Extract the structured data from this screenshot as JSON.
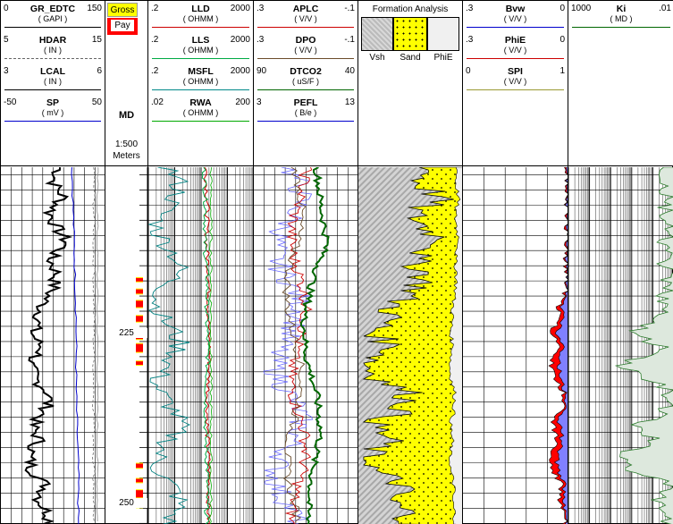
{
  "tracks": {
    "gr_track": {
      "curves": [
        {
          "name": "GR_EDTC",
          "unit": "( GAPI )",
          "min": "0",
          "max": "150",
          "color": "#000000",
          "style": "solid"
        },
        {
          "name": "HDAR",
          "unit": "( IN )",
          "min": "5",
          "max": "15",
          "color": "#666666",
          "style": "dashed"
        },
        {
          "name": "LCAL",
          "unit": "( IN )",
          "min": "3",
          "max": "6",
          "color": "#000000",
          "style": "solid"
        },
        {
          "name": "SP",
          "unit": "( mV )",
          "min": "-50",
          "max": "50",
          "color": "#0000cc",
          "style": "solid"
        }
      ]
    },
    "depth_track": {
      "gross_label": "Gross",
      "pay_label": "Pay",
      "md_label": "MD",
      "scale_label": "1:500",
      "units_label": "Meters",
      "depth_ticks": [
        {
          "depth": 225,
          "label": "225"
        },
        {
          "depth": 250,
          "label": "250"
        }
      ]
    },
    "resistivity_track": {
      "curves": [
        {
          "name": "LLD",
          "unit": "( OHMM )",
          "min": ".2",
          "max": "2000",
          "color": "#cc0000"
        },
        {
          "name": "LLS",
          "unit": "( OHMM )",
          "min": ".2",
          "max": "2000",
          "color": "#00aa44"
        },
        {
          "name": "MSFL",
          "unit": "( OHMM )",
          "min": ".2",
          "max": "2000",
          "color": "#008080"
        },
        {
          "name": "RWA",
          "unit": "( OHMM )",
          "min": ".02",
          "max": "200",
          "color": "#00aa00"
        }
      ]
    },
    "porosity_track": {
      "curves": [
        {
          "name": "APLC",
          "unit": "( V/V )",
          "min": ".3",
          "max": "-.1",
          "color": "#cc0000"
        },
        {
          "name": "DPO",
          "unit": "( V/V )",
          "min": ".3",
          "max": "-.1",
          "color": "#6b4c2a"
        },
        {
          "name": "DTCO2",
          "unit": "( uS/F )",
          "min": "90",
          "max": "40",
          "color": "#006600"
        },
        {
          "name": "PEFL",
          "unit": "( B/e )",
          "min": "3",
          "max": "13",
          "color": "#0000cc"
        }
      ]
    },
    "formation_track": {
      "title": "Formation Analysis",
      "components": [
        {
          "name": "Vsh",
          "color": "#c0c0c0"
        },
        {
          "name": "Sand",
          "color": "#ffff00"
        },
        {
          "name": "PhiE",
          "color": "#f0f0f0"
        }
      ]
    },
    "saturation_track": {
      "curves": [
        {
          "name": "Bvw",
          "unit": "( V/V )",
          "min": ".3",
          "max": "0",
          "color": "#0000cc"
        },
        {
          "name": "PhiE",
          "unit": "( V/V )",
          "min": ".3",
          "max": "0",
          "color": "#cc0000"
        },
        {
          "name": "SPI",
          "unit": "( V/V )",
          "min": "0",
          "max": "1",
          "color": "#999933"
        }
      ]
    },
    "perm_track": {
      "curves": [
        {
          "name": "Ki",
          "unit": "( MD )",
          "min": "1000",
          "max": ".01",
          "color": "#006600"
        }
      ]
    }
  },
  "chart_data": {
    "type": "line",
    "title": "",
    "y_axis": {
      "label": "MD",
      "unit": "Meters",
      "scale": "1:500",
      "range_m": [
        205,
        252
      ]
    },
    "series": [
      {
        "name": "GR_EDTC",
        "unit": "GAPI",
        "range": [
          0,
          150
        ],
        "depth": [
          205,
          207,
          209,
          211,
          213,
          215,
          217,
          219,
          221,
          223,
          225,
          227,
          229,
          231,
          233,
          235,
          237,
          239,
          241,
          243,
          245,
          247,
          249,
          251
        ],
        "values": [
          85,
          75,
          90,
          70,
          80,
          95,
          70,
          80,
          75,
          60,
          55,
          45,
          60,
          40,
          50,
          70,
          65,
          45,
          55,
          40,
          45,
          65,
          55,
          70
        ]
      },
      {
        "name": "SP",
        "unit": "mV",
        "range": [
          -50,
          50
        ],
        "depth": [
          205,
          215,
          225,
          235,
          245,
          251
        ],
        "values": [
          18,
          20,
          22,
          22,
          24,
          24
        ]
      },
      {
        "name": "LLD",
        "unit": "OHMM",
        "range": [
          0.2,
          2000
        ],
        "depth": [
          205,
          210,
          215,
          220,
          225,
          230,
          235,
          240,
          245,
          250
        ],
        "values": [
          30,
          35,
          32,
          40,
          38,
          42,
          36,
          34,
          40,
          38
        ]
      },
      {
        "name": "DTCO2",
        "unit": "uS/F",
        "range": [
          90,
          40
        ],
        "depth": [
          205,
          210,
          215,
          220,
          225,
          230,
          235,
          240,
          245,
          250
        ],
        "values": [
          60,
          58,
          55,
          62,
          66,
          65,
          60,
          58,
          62,
          64
        ]
      }
    ]
  }
}
